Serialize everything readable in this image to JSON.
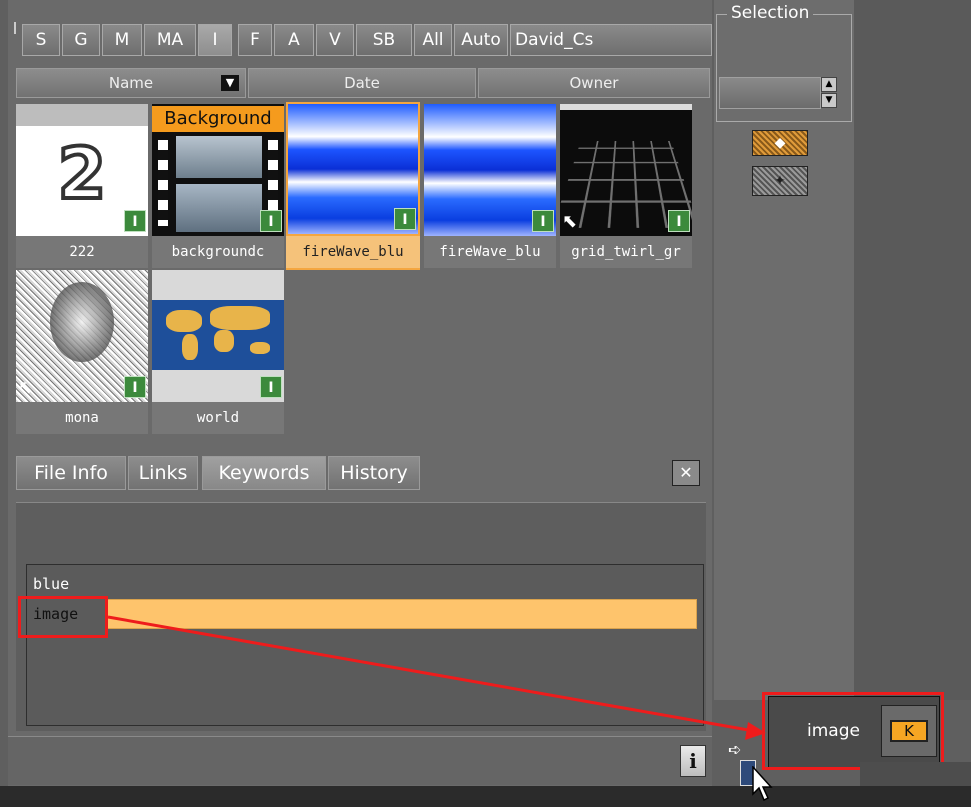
{
  "filter_tabs": [
    "S",
    "G",
    "M",
    "MA",
    "I",
    "F",
    "A",
    "V",
    "SB",
    "All",
    "Auto",
    "David_Cs"
  ],
  "active_filter_tab": "I",
  "columns": {
    "name": "Name",
    "date": "Date",
    "owner": "Owner"
  },
  "items": [
    {
      "name": "222",
      "label": "222",
      "type": "I",
      "linked": false,
      "selected": false,
      "preview_text": "2"
    },
    {
      "name": "backgroundc",
      "label": "backgroundc",
      "type": "I",
      "linked": false,
      "selected": false,
      "preview_text": "Background"
    },
    {
      "name": "fireWave_blu",
      "label": "fireWave_blu",
      "type": "I",
      "linked": false,
      "selected": true
    },
    {
      "name": "fireWave_blu",
      "label": "fireWave_blu",
      "type": "I",
      "linked": false,
      "selected": false
    },
    {
      "name": "grid_twirl_gr",
      "label": "grid_twirl_gr",
      "type": "I",
      "linked": true,
      "selected": false
    },
    {
      "name": "mona",
      "label": "mona",
      "type": "I",
      "linked": true,
      "selected": false
    },
    {
      "name": "world",
      "label": "world",
      "type": "I",
      "linked": false,
      "selected": false
    }
  ],
  "info_tabs": [
    "File Info",
    "Links",
    "Keywords",
    "History"
  ],
  "active_info_tab": "Keywords",
  "close_glyph": "✕",
  "keywords": [
    "blue",
    "image"
  ],
  "selected_keyword": "image",
  "selection": {
    "title": "Selection",
    "value": ""
  },
  "info_button": "i",
  "drag_tooltip": {
    "text": "image",
    "badge": "K"
  },
  "colors": {
    "selection": "#f4a640",
    "keyword_highlight": "#fec46c",
    "annotation": "#ee1c1c",
    "type_badge": "#3c8a3c"
  }
}
